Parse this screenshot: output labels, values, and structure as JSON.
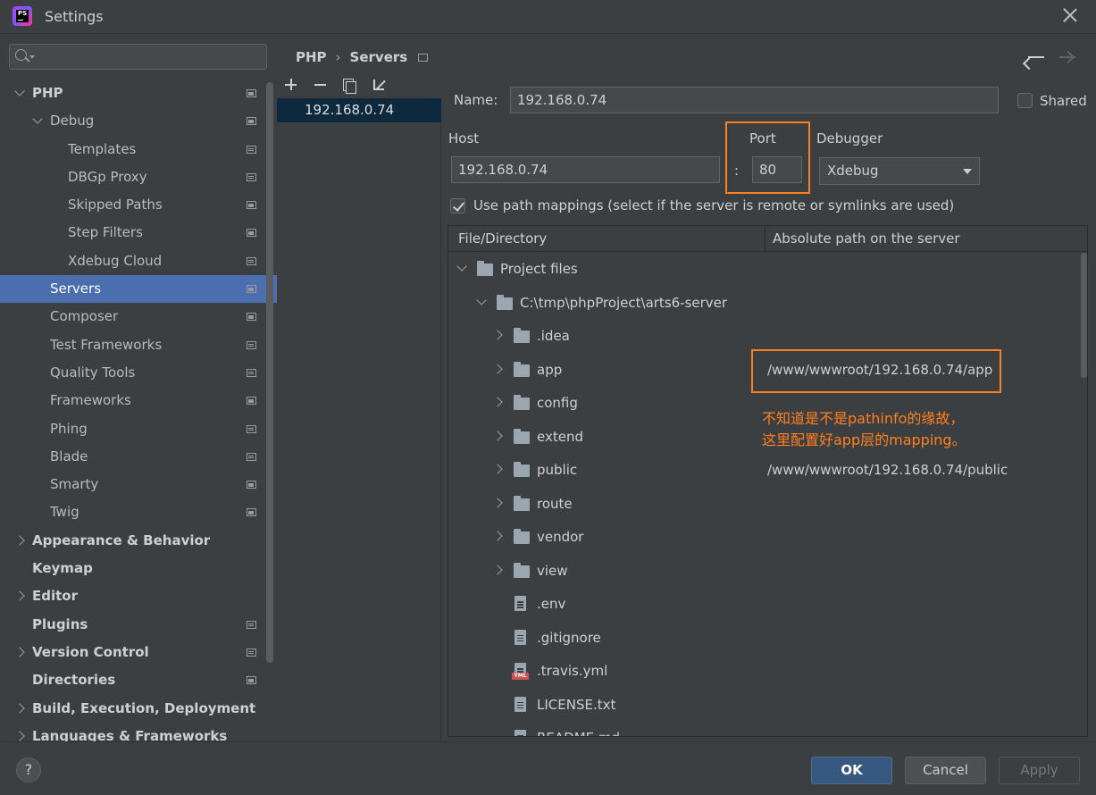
{
  "window": {
    "title": "Settings",
    "app_icon_text": "PS"
  },
  "sidebar": {
    "search_placeholder": "",
    "items": [
      {
        "label": "PHP",
        "level": 0,
        "expanded": true,
        "bold": true,
        "page_icon": true
      },
      {
        "label": "Debug",
        "level": 1,
        "expanded": true,
        "page_icon": true
      },
      {
        "label": "Templates",
        "level": 2,
        "page_icon": true
      },
      {
        "label": "DBGp Proxy",
        "level": 2,
        "page_icon": true
      },
      {
        "label": "Skipped Paths",
        "level": 2,
        "page_icon": true
      },
      {
        "label": "Step Filters",
        "level": 2,
        "page_icon": true
      },
      {
        "label": "Xdebug Cloud",
        "level": 2,
        "page_icon": true
      },
      {
        "label": "Servers",
        "level": 1,
        "selected": true,
        "page_icon": true
      },
      {
        "label": "Composer",
        "level": 1,
        "page_icon": true
      },
      {
        "label": "Test Frameworks",
        "level": 1,
        "page_icon": true
      },
      {
        "label": "Quality Tools",
        "level": 1,
        "page_icon": true
      },
      {
        "label": "Frameworks",
        "level": 1,
        "page_icon": true
      },
      {
        "label": "Phing",
        "level": 1,
        "page_icon": true
      },
      {
        "label": "Blade",
        "level": 1,
        "page_icon": true
      },
      {
        "label": "Smarty",
        "level": 1,
        "page_icon": true
      },
      {
        "label": "Twig",
        "level": 1,
        "page_icon": true
      },
      {
        "label": "Appearance & Behavior",
        "level": 0,
        "collapsed": true,
        "bold": true
      },
      {
        "label": "Keymap",
        "level": 0,
        "bold": true
      },
      {
        "label": "Editor",
        "level": 0,
        "collapsed": true,
        "bold": true
      },
      {
        "label": "Plugins",
        "level": 0,
        "bold": true,
        "page_icon": true
      },
      {
        "label": "Version Control",
        "level": 0,
        "collapsed": true,
        "bold": true,
        "page_icon": true
      },
      {
        "label": "Directories",
        "level": 0,
        "bold": true,
        "page_icon": true
      },
      {
        "label": "Build, Execution, Deployment",
        "level": 0,
        "collapsed": true,
        "bold": true
      },
      {
        "label": "Languages & Frameworks",
        "level": 0,
        "collapsed": true,
        "bold": true
      }
    ]
  },
  "breadcrumb": {
    "parent": "PHP",
    "current": "Servers"
  },
  "server_list": {
    "items": [
      "192.168.0.74"
    ]
  },
  "server_form": {
    "name_label": "Name:",
    "name_value": "192.168.0.74",
    "shared_label": "Shared",
    "host_label": "Host",
    "host_value": "192.168.0.74",
    "port_label": "Port",
    "port_separator": ":",
    "port_value": "80",
    "debugger_label": "Debugger",
    "debugger_value": "Xdebug",
    "path_mappings_label": "Use path mappings (select if the server is remote or symlinks are used)"
  },
  "mapping_table": {
    "columns": [
      "File/Directory",
      "Absolute path on the server"
    ],
    "rows": [
      {
        "name": "Project files",
        "type": "folder",
        "depth": 0,
        "toggle": "down",
        "server_path": ""
      },
      {
        "name": "C:\\tmp\\phpProject\\arts6-server",
        "type": "folder",
        "depth": 1,
        "toggle": "down",
        "server_path": ""
      },
      {
        "name": ".idea",
        "type": "folder",
        "depth": 2,
        "toggle": "right",
        "server_path": ""
      },
      {
        "name": "app",
        "type": "folder",
        "depth": 2,
        "toggle": "right",
        "server_path": "/www/wwwroot/192.168.0.74/app"
      },
      {
        "name": "config",
        "type": "folder",
        "depth": 2,
        "toggle": "right",
        "server_path": ""
      },
      {
        "name": "extend",
        "type": "folder",
        "depth": 2,
        "toggle": "right",
        "server_path": ""
      },
      {
        "name": "public",
        "type": "folder",
        "depth": 2,
        "toggle": "right",
        "server_path": "/www/wwwroot/192.168.0.74/public"
      },
      {
        "name": "route",
        "type": "folder",
        "depth": 2,
        "toggle": "right",
        "server_path": ""
      },
      {
        "name": "vendor",
        "type": "folder",
        "depth": 2,
        "toggle": "right",
        "server_path": ""
      },
      {
        "name": "view",
        "type": "folder",
        "depth": 2,
        "toggle": "right",
        "server_path": ""
      },
      {
        "name": ".env",
        "type": "file",
        "depth": 2,
        "server_path": ""
      },
      {
        "name": ".gitignore",
        "type": "file",
        "depth": 2,
        "server_path": ""
      },
      {
        "name": ".travis.yml",
        "type": "yml",
        "depth": 2,
        "server_path": ""
      },
      {
        "name": "LICENSE.txt",
        "type": "file",
        "depth": 2,
        "server_path": ""
      },
      {
        "name": "README.md",
        "type": "file",
        "depth": 2,
        "server_path": ""
      }
    ]
  },
  "annotation": {
    "line1": "不知道是不是pathinfo的缘故，",
    "line2": "这里配置好app层的mapping。"
  },
  "footer": {
    "help": "?",
    "ok": "OK",
    "cancel": "Cancel",
    "apply": "Apply"
  },
  "colors": {
    "selection": "#4b6eaf",
    "annotation": "#ff7f1e",
    "primary_button": "#365880"
  }
}
